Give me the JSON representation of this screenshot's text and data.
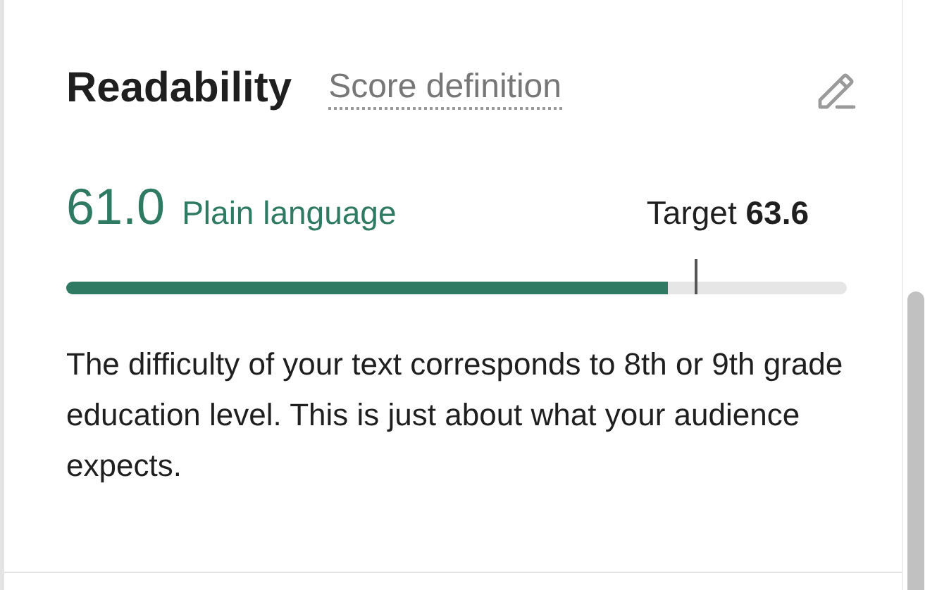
{
  "title": "Readability",
  "definition_link": "Score definition",
  "score": {
    "value": "61.0",
    "label": "Plain language",
    "target_label": "Target",
    "target_value": "63.6"
  },
  "bar": {
    "level": 0.77
  },
  "target_marker": {
    "level": 0.805
  },
  "description": "The difficulty of your text corresponds to 8th or 9th grade education level. This is just about what your audience expects."
}
